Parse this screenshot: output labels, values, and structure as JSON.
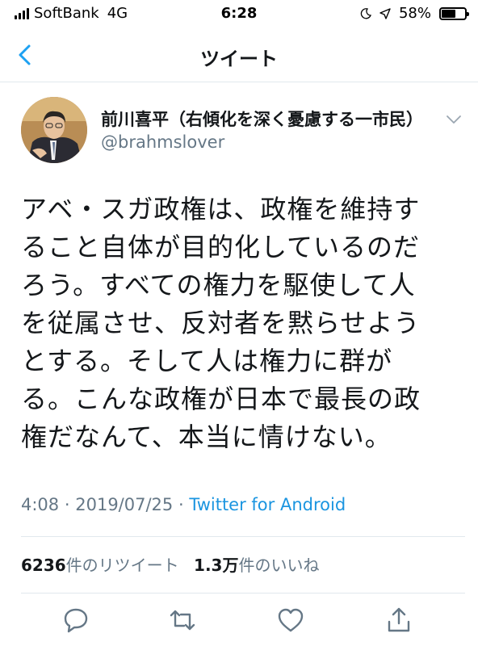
{
  "status_bar": {
    "carrier": "SoftBank",
    "network": "4G",
    "time": "6:28",
    "battery_percent": "58%",
    "battery_level": 0.58,
    "icons": [
      "signal-icon",
      "moon-icon",
      "location-arrow-icon",
      "battery-icon"
    ]
  },
  "nav": {
    "title": "ツイート",
    "back_icon": "chevron-left-icon"
  },
  "tweet": {
    "author_name": "前川喜平（右傾化を深く憂慮する一市民）",
    "author_handle": "@brahmslover",
    "text": "アベ・スガ政権は、政権を維持す\nること自体が目的化しているのだ\nろう。すべての権力を駆使して人\nを従属させ、反対者を黙らせよう\nとする。そして人は権力に群が\nる。こんな政権が日本で最長の政\n権だなんて、本当に情けない。",
    "time": "4:08",
    "date": "2019/07/25",
    "separator": "·",
    "client": "Twitter for Android"
  },
  "stats": {
    "retweet_count": "6236",
    "retweet_label": "件のリツイート",
    "like_count": "1.3万",
    "like_label": "件のいいね"
  },
  "actions": [
    "reply-icon",
    "retweet-icon",
    "like-icon",
    "share-icon"
  ],
  "colors": {
    "accent": "#1da1f2",
    "link": "#1b95e0",
    "secondary_text": "#657786",
    "divider": "#e1e8ed"
  }
}
